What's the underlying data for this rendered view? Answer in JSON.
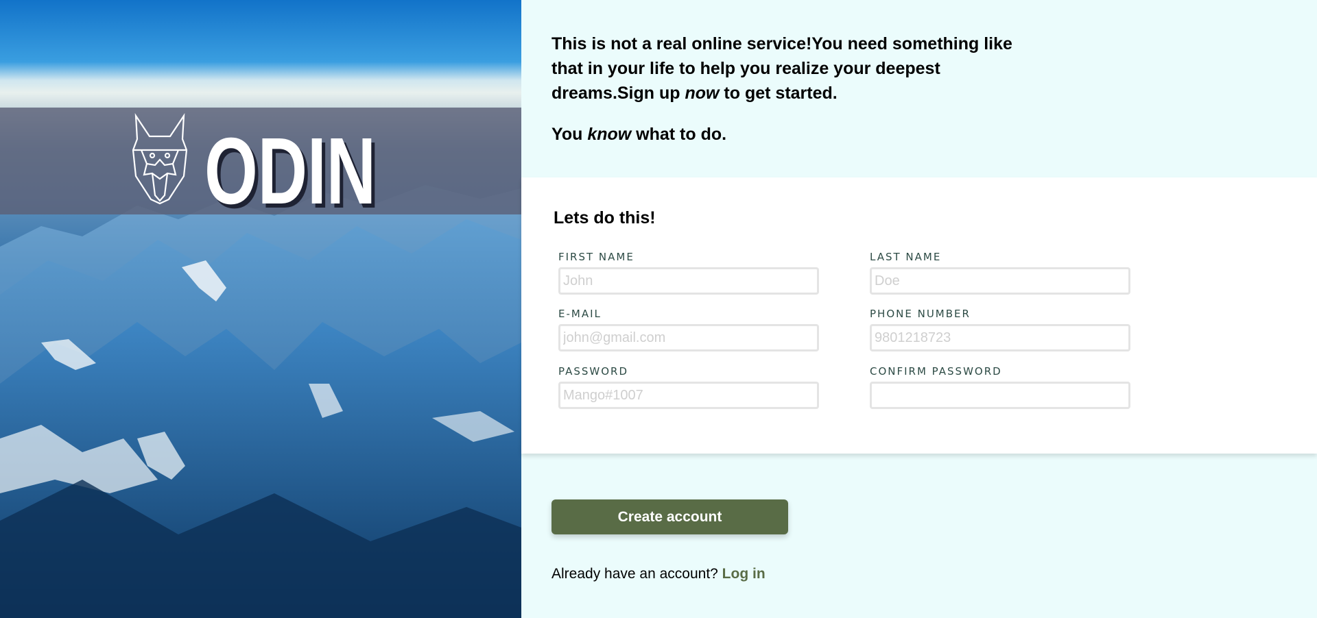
{
  "hero": {
    "logo_text": "ODIN"
  },
  "intro": {
    "line1_part1": "This is not a real online service!You need something like that in your life to help you realize your deepest dreams.Sign up ",
    "line1_em": "now",
    "line1_part2": " to get started.",
    "line2_part1": "You ",
    "line2_em": "know",
    "line2_part2": " what to do."
  },
  "form": {
    "title": "Lets do this!",
    "fields": [
      {
        "label": "FIRST NAME",
        "placeholder": "John",
        "value": ""
      },
      {
        "label": "LAST NAME",
        "placeholder": "Doe",
        "value": ""
      },
      {
        "label": "E-MAIL",
        "placeholder": "john@gmail.com",
        "value": ""
      },
      {
        "label": "PHONE NUMBER",
        "placeholder": "9801218723",
        "value": ""
      },
      {
        "label": "PASSWORD",
        "placeholder": "Mango#1007",
        "value": ""
      },
      {
        "label": "CONFIRM PASSWORD",
        "placeholder": "",
        "value": ""
      }
    ]
  },
  "actions": {
    "create_label": "Create account",
    "login_prompt": "Already have an account? ",
    "login_link": "Log in"
  },
  "colors": {
    "page_bg": "#ebfcfc",
    "accent": "#596c46",
    "label": "#2c4a44"
  }
}
